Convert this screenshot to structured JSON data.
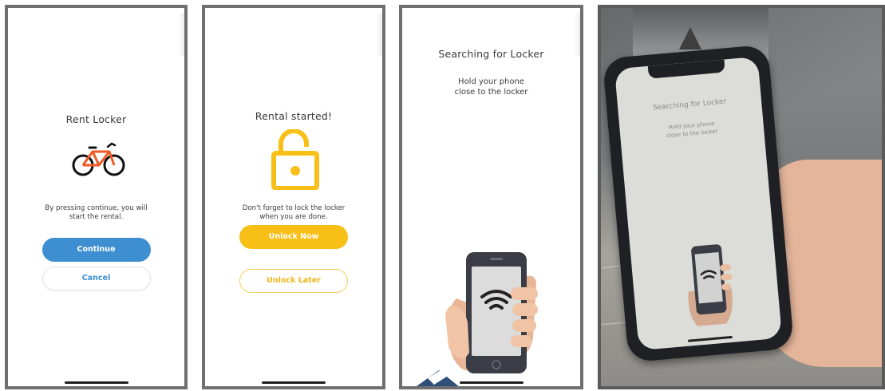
{
  "screens": [
    {
      "title": "Rent Locker",
      "message_line1": "By pressing continue, you will",
      "message_line2": "start the rental.",
      "primary_button": "Continue",
      "secondary_button": "Cancel",
      "icon": "bicycle-icon"
    },
    {
      "title": "Rental started!",
      "message_line1": "Don't forget to lock the locker",
      "message_line2": "when you are done.",
      "primary_button": "Unlock Now",
      "secondary_button": "Unlock Later",
      "icon": "unlocked-padlock-icon"
    },
    {
      "title": "Searching for Locker",
      "message_line1": "Hold your phone",
      "message_line2": "close to the locker",
      "icon": "hand-holding-phone-icon"
    }
  ],
  "photo": {
    "title": "Searching for Locker",
    "message_line1": "Hold your phone",
    "message_line2": "close to the locker"
  },
  "colors": {
    "blue": "#3d8fd1",
    "yellow": "#f8bf17",
    "bike_orange": "#f15a24"
  }
}
